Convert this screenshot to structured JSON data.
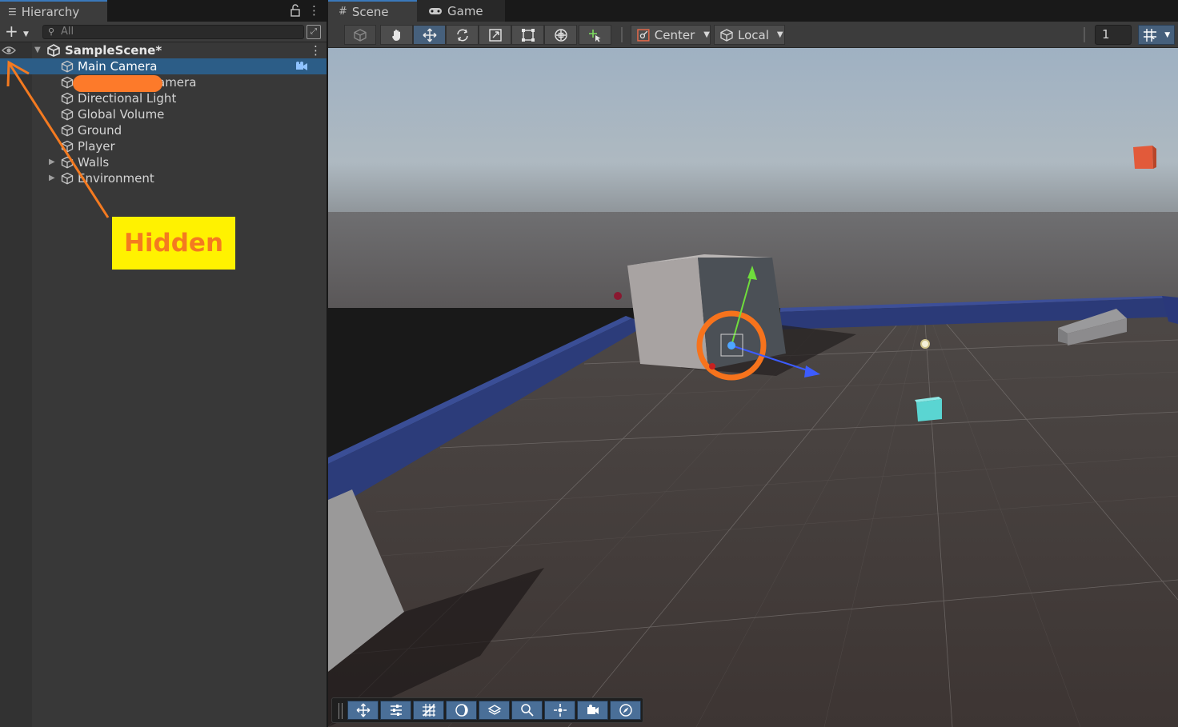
{
  "hierarchy": {
    "tab_label": "Hierarchy",
    "search_placeholder": "All",
    "scene_name": "SampleScene*",
    "items": [
      {
        "label": "Main Camera",
        "selected": true,
        "foldout": false
      },
      {
        "label": "amera",
        "selected": false,
        "foldout": false
      },
      {
        "label": "Directional Light",
        "selected": false,
        "foldout": false
      },
      {
        "label": "Global Volume",
        "selected": false,
        "foldout": false
      },
      {
        "label": "Ground",
        "selected": false,
        "foldout": false
      },
      {
        "label": "Player",
        "selected": false,
        "foldout": false
      },
      {
        "label": "Walls",
        "selected": false,
        "foldout": true
      },
      {
        "label": "Environment",
        "selected": false,
        "foldout": true
      }
    ]
  },
  "annotation": {
    "label": "Hidden",
    "color": "#f47a20",
    "background": "#fff200"
  },
  "scene_view": {
    "tabs": [
      {
        "label": "Scene",
        "icon": "grid-icon",
        "active": true
      },
      {
        "label": "Game",
        "icon": "gamepad-icon",
        "active": false
      }
    ],
    "tools": [
      "view-tool",
      "hand-tool",
      "move-tool",
      "rotate-tool",
      "scale-tool",
      "rect-tool",
      "transform-tool",
      "custom-tool"
    ],
    "active_tool": "move-tool",
    "pivot_mode": "Center",
    "pivot_rotation": "Local",
    "snap_increment": "1",
    "overlay_tools": [
      "move-icon",
      "sliders-icon",
      "grid-toggle-icon",
      "shading-icon",
      "layers-icon",
      "search-icon",
      "orientation-icon",
      "camera-icon",
      "compass-icon"
    ]
  },
  "colors": {
    "accent": "#2c5d87",
    "tool_active": "#46607c",
    "sky_top": "#a4b2bd",
    "ground": "#3b3534",
    "wall": "#2a3a74",
    "highlight_circle": "#f7731c"
  }
}
